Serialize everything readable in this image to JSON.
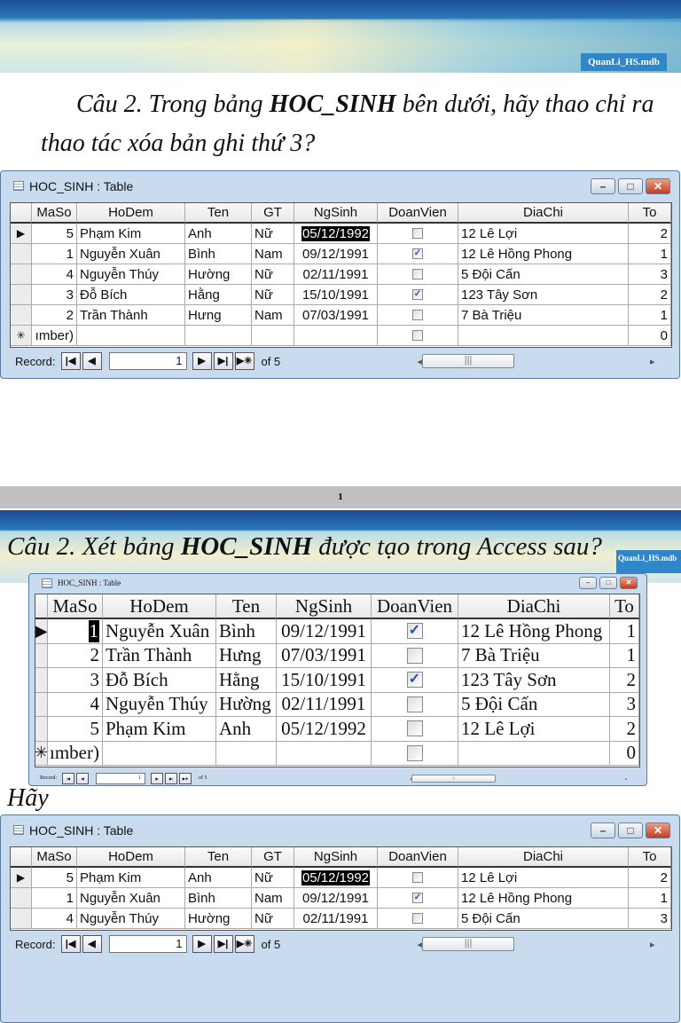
{
  "slide1": {
    "file_label": "QuanLi_HS.mdb",
    "question": "Câu 2. Trong bảng HOC_SINH bên dưới, hãy thao chỉ ra thao tác xóa bản ghi thứ 3?",
    "question_parts": [
      "Câu 2. Trong bảng ",
      "HOC_SINH",
      " bên dưới, hãy thao chỉ ra thao tác xóa bản ghi thứ 3?"
    ]
  },
  "page_number": "1",
  "slide2": {
    "file_label": "QuanLi_HS.mdb",
    "question_parts": [
      "Câu 2. Xét bảng ",
      "HOC_SINH",
      " được tạo trong Access sau?"
    ],
    "trailing_text": "Hãy"
  },
  "tables": [
    {
      "title": "HOC_SINH : Table",
      "columns": [
        "MaSo",
        "HoDem",
        "Ten",
        "GT",
        "NgSinh",
        "DoanVien",
        "DiaChi",
        "To"
      ],
      "rows": [
        [
          "5",
          "Phạm Kim",
          "Anh",
          "Nữ",
          "05/12/1992",
          false,
          "12 Lê Lợi",
          "2"
        ],
        [
          "1",
          "Nguyễn Xuân",
          "Bình",
          "Nam",
          "09/12/1991",
          true,
          "12 Lê Hồng Phong",
          "1"
        ],
        [
          "4",
          "Nguyễn Thúy",
          "Hường",
          "Nữ",
          "02/11/1991",
          false,
          "5 Đội Cấn",
          "3"
        ],
        [
          "3",
          "Đỗ Bích",
          "Hằng",
          "Nữ",
          "15/10/1991",
          true,
          "123 Tây Sơn",
          "2"
        ],
        [
          "2",
          "Trần Thành",
          "Hưng",
          "Nam",
          "07/03/1991",
          false,
          "7 Bà Triệu",
          "1"
        ]
      ],
      "new_row": [
        "ımber)",
        "",
        "",
        "",
        "",
        false,
        "",
        "0"
      ],
      "record_label": "Record:",
      "record_value": "1",
      "record_of": "of 5"
    },
    {
      "title": "HOC_SINH : Table",
      "columns": [
        "MaSo",
        "HoDem",
        "Ten",
        "NgSinh",
        "DoanVien",
        "DiaChi",
        "To"
      ],
      "rows": [
        [
          "1",
          "Nguyễn Xuân",
          "Bình",
          "09/12/1991",
          true,
          "12 Lê Hồng Phong",
          "1"
        ],
        [
          "2",
          "Trần Thành",
          "Hưng",
          "07/03/1991",
          false,
          "7 Bà Triệu",
          "1"
        ],
        [
          "3",
          "Đỗ Bích",
          "Hằng",
          "15/10/1991",
          true,
          "123 Tây Sơn",
          "2"
        ],
        [
          "4",
          "Nguyễn Thúy",
          "Hường",
          "02/11/1991",
          false,
          "5 Đội Cấn",
          "3"
        ],
        [
          "5",
          "Phạm Kim",
          "Anh",
          "05/12/1992",
          false,
          "12 Lê Lợi",
          "2"
        ]
      ],
      "new_row": [
        "ımber)",
        "",
        "",
        "",
        false,
        "",
        "0"
      ],
      "record_label": "Record:",
      "record_value": "1",
      "record_of": "of 5"
    },
    {
      "title": "HOC_SINH : Table",
      "columns": [
        "MaSo",
        "HoDem",
        "Ten",
        "GT",
        "NgSinh",
        "DoanVien",
        "DiaChi",
        "To"
      ],
      "rows": [
        [
          "5",
          "Phạm Kim",
          "Anh",
          "Nữ",
          "05/12/1992",
          false,
          "12 Lê Lợi",
          "2"
        ],
        [
          "1",
          "Nguyễn Xuân",
          "Bình",
          "Nam",
          "09/12/1991",
          true,
          "12 Lê Hồng Phong",
          "1"
        ],
        [
          "4",
          "Nguyễn Thúy",
          "Hường",
          "Nữ",
          "02/11/1991",
          false,
          "5 Đội Cấn",
          "3"
        ]
      ],
      "new_row": null,
      "record_label": "Record:",
      "record_value": "1",
      "record_of": "of 5"
    }
  ]
}
